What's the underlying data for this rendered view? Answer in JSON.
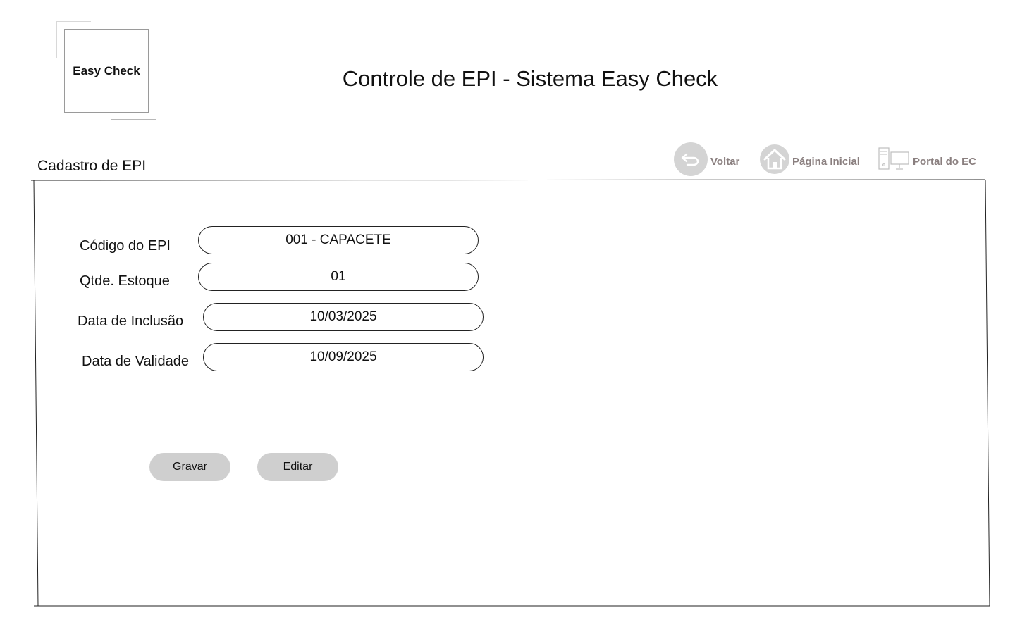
{
  "logo": {
    "text": "Easy Check"
  },
  "header": {
    "title": "Controle de EPI - Sistema Easy Check"
  },
  "section": {
    "title": "Cadastro de EPI"
  },
  "nav": {
    "back": {
      "label": "Voltar",
      "icon": "back-arrow-icon"
    },
    "home": {
      "label": "Página Inicial",
      "icon": "home-icon"
    },
    "portal": {
      "label": "Portal do EC",
      "icon": "computer-icon"
    }
  },
  "form": {
    "fields": [
      {
        "label": "Código do EPI",
        "value": "001 - CAPACETE"
      },
      {
        "label": "Qtde. Estoque",
        "value": "01"
      },
      {
        "label": "Data de Inclusão",
        "value": "10/03/2025"
      },
      {
        "label": "Data de Validade",
        "value": "10/09/2025"
      }
    ]
  },
  "actions": {
    "save_label": "Gravar",
    "edit_label": "Editar"
  },
  "colors": {
    "nav_text": "#8a7f7f",
    "icon_bg": "#d4d4d4",
    "button_bg": "#cfcfcf"
  }
}
